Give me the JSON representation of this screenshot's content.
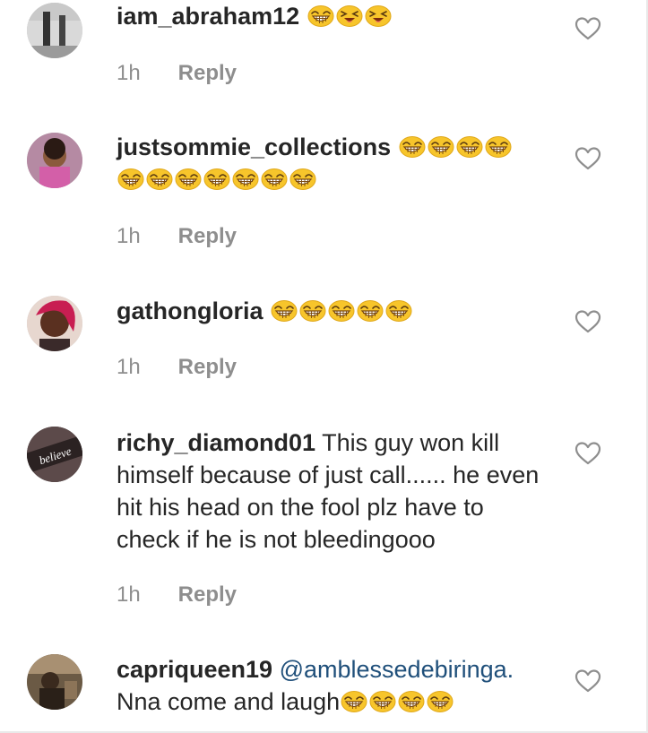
{
  "comments": [
    {
      "username": "iam_abraham12",
      "mention": "",
      "text": "",
      "emoji": [
        "grinning-squint-face",
        "squinting-face",
        "squinting-face"
      ],
      "emoji_after_text": [],
      "time": "1h",
      "reply_label": "Reply"
    },
    {
      "username": "justsommie_collections",
      "mention": "",
      "text": "",
      "emoji": [
        "grinning-squint-face",
        "grinning-squint-face",
        "grinning-squint-face",
        "grinning-squint-face",
        "grinning-squint-face",
        "grinning-squint-face",
        "grinning-squint-face",
        "grinning-squint-face",
        "grinning-squint-face",
        "grinning-squint-face",
        "grinning-squint-face"
      ],
      "emoji_after_text": [],
      "time": "1h",
      "reply_label": "Reply"
    },
    {
      "username": "gathongloria",
      "mention": "",
      "text": "",
      "emoji": [
        "grinning-squint-face",
        "grinning-squint-face",
        "grinning-squint-face",
        "grinning-squint-face",
        "grinning-squint-face"
      ],
      "emoji_after_text": [],
      "time": "1h",
      "reply_label": "Reply"
    },
    {
      "username": "richy_diamond01",
      "mention": "",
      "text": "This guy won kill himself because of just call...... he even hit his head on the fool plz have to check if he is not bleedingooo",
      "emoji": [],
      "emoji_after_text": [],
      "time": "1h",
      "reply_label": "Reply"
    },
    {
      "username": "capriqueen19",
      "mention": "@amblessedebiringa.",
      "text": "Nna come and laugh",
      "emoji": [],
      "emoji_after_text": [
        "grinning-squint-face",
        "grinning-squint-face",
        "grinning-squint-face",
        "grinning-squint-face"
      ],
      "time": "",
      "reply_label": ""
    }
  ],
  "avatar_text": {
    "richy": "believe"
  },
  "colors": {
    "username": "#262626",
    "meta": "#8e8e8e",
    "mention": "#1f4f7a",
    "emoji_face": "#f7c52b",
    "heart_stroke": "#8e8e8e"
  },
  "icons": {
    "like": "heart-outline-icon",
    "emoji": "grinning-squint-face"
  }
}
